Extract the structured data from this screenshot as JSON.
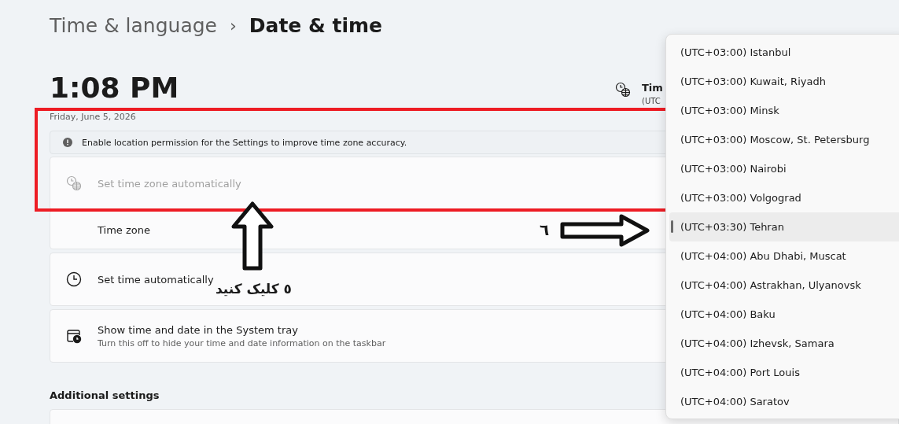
{
  "breadcrumb": {
    "parent": "Time & language",
    "separator": "›",
    "current": "Date & time"
  },
  "clock": {
    "time": "1:08 PM",
    "date": "Friday, June 5, 2026"
  },
  "time_zone_summary": {
    "label": "Tim",
    "value": "(UTC"
  },
  "info_bar": {
    "text": "Enable location permission for the Settings to improve time zone accuracy."
  },
  "settings": [
    {
      "kind": "clock-globe",
      "label": "Set time zone automatically",
      "disabled": true
    },
    {
      "kind": "plain",
      "label": "Time zone",
      "disabled": false
    },
    {
      "kind": "clock",
      "label": "Set time automatically",
      "disabled": false
    },
    {
      "kind": "calendar-clock",
      "label": "Show time and date in the System tray",
      "description": "Turn this off to hide your time and date information on the taskbar",
      "disabled": false
    }
  ],
  "section_title": "Additional settings",
  "dropdown": {
    "options": [
      {
        "label": "(UTC+03:00) Istanbul",
        "selected": false
      },
      {
        "label": "(UTC+03:00) Kuwait, Riyadh",
        "selected": false
      },
      {
        "label": "(UTC+03:00) Minsk",
        "selected": false
      },
      {
        "label": "(UTC+03:00) Moscow, St. Petersburg",
        "selected": false
      },
      {
        "label": "(UTC+03:00) Nairobi",
        "selected": false
      },
      {
        "label": "(UTC+03:00) Volgograd",
        "selected": false
      },
      {
        "label": "(UTC+03:30) Tehran",
        "selected": true
      },
      {
        "label": "(UTC+04:00) Abu Dhabi, Muscat",
        "selected": false
      },
      {
        "label": "(UTC+04:00) Astrakhan, Ulyanovsk",
        "selected": false
      },
      {
        "label": "(UTC+04:00) Baku",
        "selected": false
      },
      {
        "label": "(UTC+04:00) Izhevsk, Samara",
        "selected": false
      },
      {
        "label": "(UTC+04:00) Port Louis",
        "selected": false
      },
      {
        "label": "(UTC+04:00) Saratov",
        "selected": false
      }
    ]
  },
  "annotations": [
    {
      "kind": "highlight-box"
    },
    {
      "kind": "up-arrow",
      "text": "٥ کلیک کنید"
    },
    {
      "kind": "right-arrow",
      "text": "٦"
    }
  ]
}
